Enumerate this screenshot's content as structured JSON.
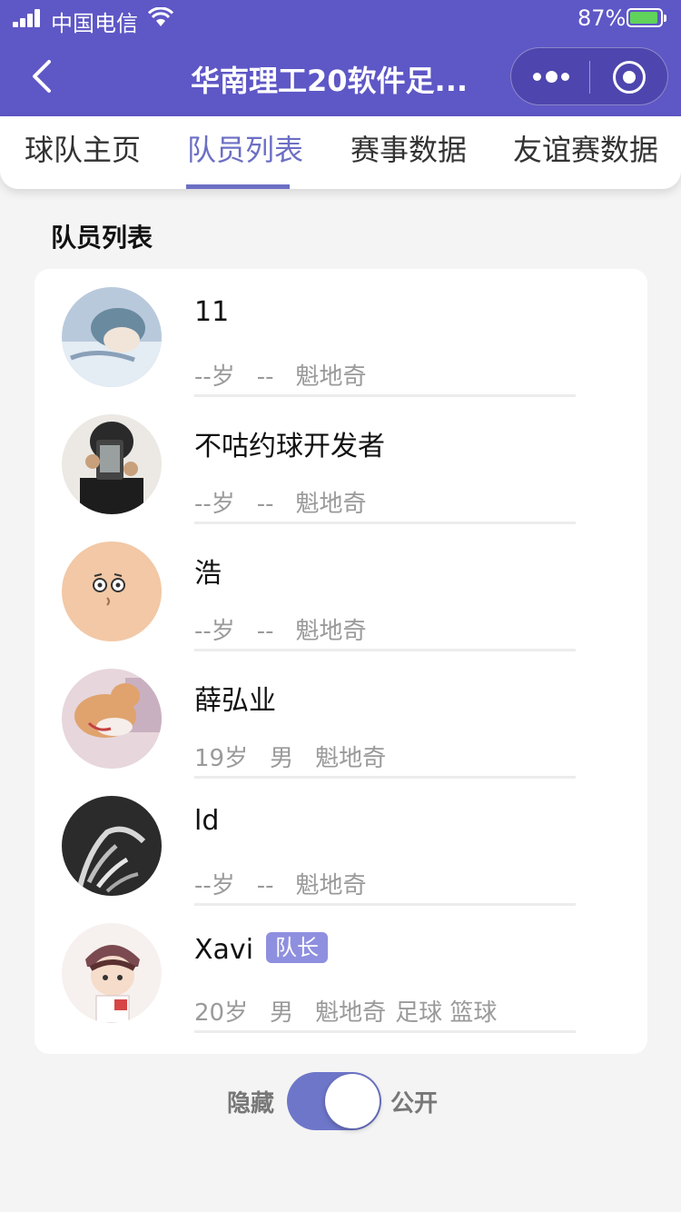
{
  "status_bar": {
    "carrier": "中国电信",
    "battery": "87%"
  },
  "nav": {
    "title": "华南理工20软件足..."
  },
  "tabs": [
    {
      "label": "球队主页"
    },
    {
      "label": "队员列表",
      "active": true
    },
    {
      "label": "赛事数据"
    },
    {
      "label": "友谊赛数据"
    }
  ],
  "section_title": "队员列表",
  "players": [
    {
      "name": "11",
      "age": "--岁",
      "gender": "--",
      "position": "魁地奇",
      "sports": ""
    },
    {
      "name": "不咕约球开发者",
      "age": "--岁",
      "gender": "--",
      "position": "魁地奇",
      "sports": ""
    },
    {
      "name": "浩",
      "age": "--岁",
      "gender": "--",
      "position": "魁地奇",
      "sports": ""
    },
    {
      "name": "薛弘业",
      "age": "19岁",
      "gender": "男",
      "position": "魁地奇",
      "sports": ""
    },
    {
      "name": "ld",
      "age": "--岁",
      "gender": "--",
      "position": "魁地奇",
      "sports": ""
    },
    {
      "name": "Xavi",
      "badge": "队长",
      "age": "20岁",
      "gender": "男",
      "position": "魁地奇",
      "sports": "足球 篮球"
    }
  ],
  "visibility_toggle": {
    "left_label": "隐藏",
    "right_label": "公开",
    "state": "公开"
  },
  "colors": {
    "nav_bg": "#5e57c6",
    "accent": "#6c6fc4",
    "badge_bg": "#8f8fe0"
  }
}
